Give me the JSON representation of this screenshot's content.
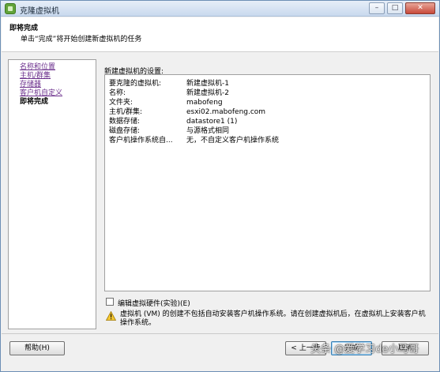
{
  "window": {
    "title": "克隆虚拟机",
    "minimize": "–",
    "maximize": "□",
    "close": "✕"
  },
  "header": {
    "title": "即将完成",
    "subtitle": "单击“完成”将开始创建新虚拟机的任务"
  },
  "nav": {
    "items": [
      {
        "label": "名称和位置",
        "current": false
      },
      {
        "label": "主机/群集",
        "current": false
      },
      {
        "label": "存储器",
        "current": false
      },
      {
        "label": "客户机自定义",
        "current": false
      },
      {
        "label": "即将完成",
        "current": true
      }
    ]
  },
  "settings": {
    "label": "新建虚拟机的设置:",
    "rows": [
      {
        "key": "要克隆的虚拟机:",
        "value": "新建虚拟机-1"
      },
      {
        "key": "名称:",
        "value": "新建虚拟机-2"
      },
      {
        "key": "文件夹:",
        "value": "mabofeng"
      },
      {
        "key": "主机/群集:",
        "value": "esxi02.mabofeng.com"
      },
      {
        "key": "数据存储:",
        "value": "datastore1 (1)"
      },
      {
        "key": "磁盘存储:",
        "value": "与源格式相同"
      },
      {
        "key": "客户机操作系统自...",
        "value": "无，不自定义客户机操作系统"
      }
    ]
  },
  "edit_hardware": {
    "label": "编辑虚拟硬件(实验)(E)",
    "checked": false
  },
  "warning": {
    "text": "虚拟机 (VM) 的创建不包括自动安装客户机操作系统。请在创建虚拟机后，在虚拟机上安装客户机操作系统。"
  },
  "buttons": {
    "help": "帮助(H)",
    "back": "< 上一步",
    "finish": "完成",
    "cancel": "取消"
  },
  "watermark": "头条 @爱学习de小马哥"
}
